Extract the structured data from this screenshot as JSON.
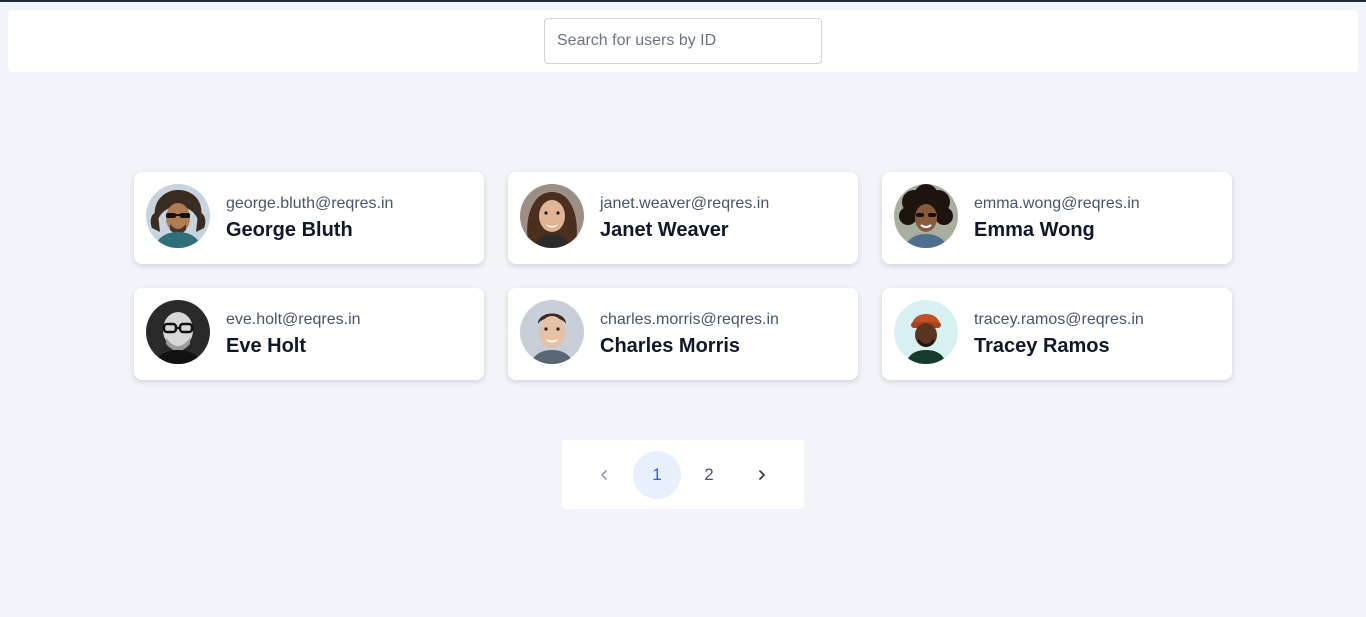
{
  "search": {
    "placeholder": "Search for users by ID",
    "value": ""
  },
  "users": [
    {
      "email": "george.bluth@reqres.in",
      "name": "George Bluth"
    },
    {
      "email": "janet.weaver@reqres.in",
      "name": "Janet Weaver"
    },
    {
      "email": "emma.wong@reqres.in",
      "name": "Emma Wong"
    },
    {
      "email": "eve.holt@reqres.in",
      "name": "Eve Holt"
    },
    {
      "email": "charles.morris@reqres.in",
      "name": "Charles Morris"
    },
    {
      "email": "tracey.ramos@reqres.in",
      "name": "Tracey Ramos"
    }
  ],
  "pagination": {
    "pages": [
      "1",
      "2"
    ],
    "current_page": "1",
    "prev_icon": "chevron-left-icon",
    "next_icon": "chevron-right-icon"
  },
  "colors": {
    "background": "#f1f4f8",
    "active_page_bg": "#e8f0fd",
    "active_page_text": "#2563eb"
  }
}
